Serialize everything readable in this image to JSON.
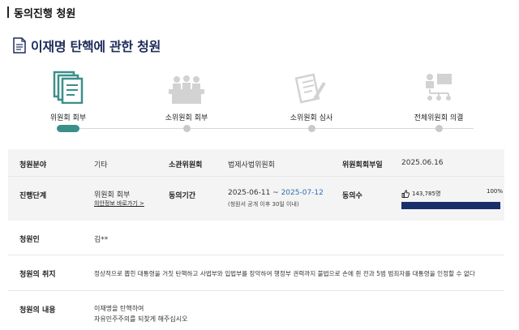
{
  "header": {
    "section_title": "동의진행 청원"
  },
  "petition": {
    "title": "이재명 탄핵에 관한 청원"
  },
  "steps": [
    {
      "label": "위원회 회부",
      "icon": "documents-icon",
      "active": true
    },
    {
      "label": "소위원회 회부",
      "icon": "meeting-table-icon",
      "active": false
    },
    {
      "label": "소위원회 심사",
      "icon": "review-document-icon",
      "active": false
    },
    {
      "label": "전체위원회 의결",
      "icon": "org-chart-icon",
      "active": false
    }
  ],
  "info": {
    "field": {
      "label": "청원분야",
      "value": "기타"
    },
    "committee": {
      "label": "소관위원회",
      "value": "법제사법위원회"
    },
    "referral_date": {
      "label": "위원회회부일",
      "value": "2025.06.16"
    },
    "stage": {
      "label": "진행단계",
      "value": "위원회 회부",
      "link": "의안정보 바로가기 >"
    },
    "period": {
      "label": "동의기간",
      "start": "2025-06-11 ~ ",
      "end": "2025-07-12",
      "note": "(청원서 공개 이후 30일 이내)"
    },
    "consent": {
      "label": "동의수",
      "count": "143,785명",
      "percent_text": "100%",
      "progress": 1.0
    },
    "petitioner": {
      "label": "청원인",
      "value": "김**"
    },
    "purpose": {
      "label": "청원의 취지",
      "value": "정상적으로 뽑힌 대통령을 거짓 탄핵하고 사법부와 입법부를 장악하여 행정부 권력까지 불법으로 손에 쥔 전과 5범 범죄자를 대통령을 인정할 수 없다"
    },
    "content": {
      "label": "청원의 내용",
      "line1": "이재명을 탄핵하여",
      "line2": "자유민주주의를 되찾게 해주십시오"
    }
  },
  "colors": {
    "title": "#1f2d5a",
    "active_step": "#3b8f8a",
    "progress_fill": "#1a2e6a",
    "period_end": "#2f6db5"
  }
}
